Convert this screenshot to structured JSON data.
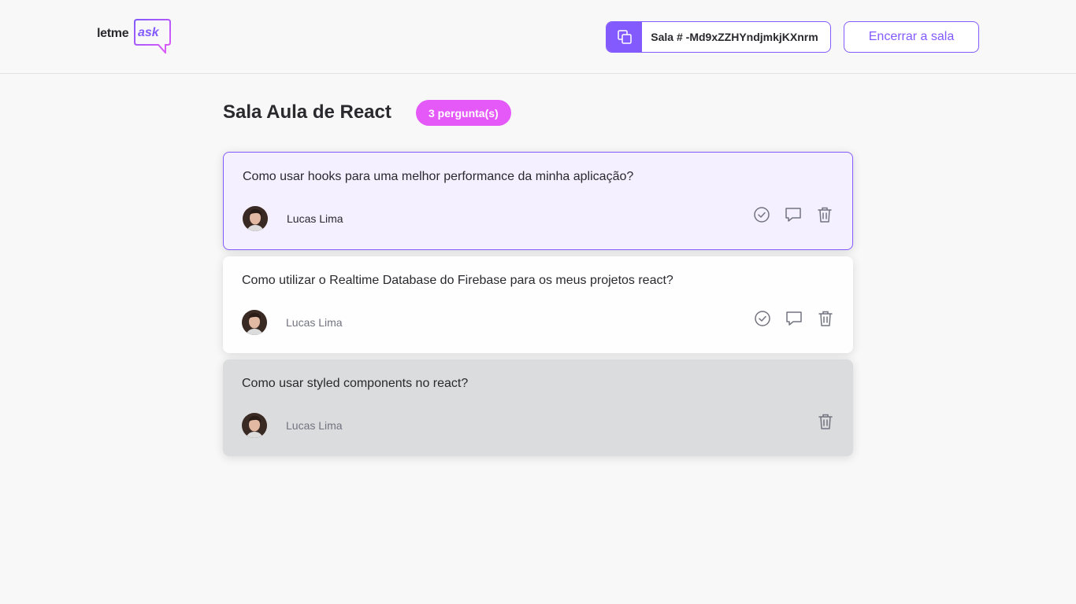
{
  "header": {
    "logo": {
      "part1": "letme",
      "part2": "ask"
    },
    "room_code": "Sala # -Md9xZZHYndjmkjKXnrm",
    "close_room_label": "Encerrar a sala"
  },
  "room": {
    "title": "Sala Aula de React",
    "question_count": "3 pergunta(s)"
  },
  "questions": [
    {
      "content": "Como usar hooks para uma melhor performance da minha aplicação?",
      "author": "Lucas Lima",
      "state": "highlighted",
      "actions": [
        "check-icon",
        "comment-icon",
        "trash-icon"
      ]
    },
    {
      "content": "Como utilizar o Realtime Database do Firebase para os meus projetos react?",
      "author": "Lucas Lima",
      "state": "normal",
      "actions": [
        "check-icon",
        "comment-icon",
        "trash-icon"
      ]
    },
    {
      "content": "Como usar styled components no react?",
      "author": "Lucas Lima",
      "state": "answered",
      "actions": [
        "trash-icon"
      ]
    }
  ],
  "colors": {
    "primary": "#835afd",
    "badge": "#e559f9",
    "highlight_bg": "#f4f0ff",
    "answered_bg": "#dbdcdd",
    "text": "#29292e",
    "muted": "#737380"
  }
}
